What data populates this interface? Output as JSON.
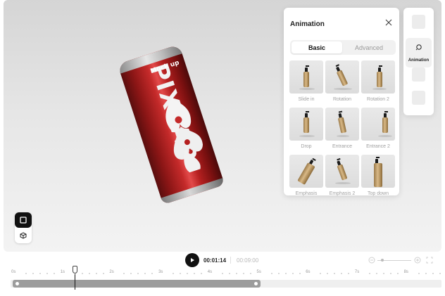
{
  "canvas": {
    "product": {
      "brand_text": "PIXCAP",
      "mock_text": "Mock up"
    }
  },
  "view_toggles": [
    {
      "name": "2d-view",
      "active": true
    },
    {
      "name": "3d-view",
      "active": false
    }
  ],
  "animation_panel": {
    "title": "Animation",
    "tabs": [
      {
        "label": "Basic",
        "active": true
      },
      {
        "label": "Advanced",
        "active": false
      }
    ],
    "presets": [
      {
        "label": "Slide in"
      },
      {
        "label": "Rotation"
      },
      {
        "label": "Rotation 2"
      },
      {
        "label": "Drop"
      },
      {
        "label": "Entrance"
      },
      {
        "label": "Entrance 2"
      },
      {
        "label": "Emphasis"
      },
      {
        "label": "Emphasis 2"
      },
      {
        "label": "Top down"
      }
    ]
  },
  "right_rail": {
    "active_label": "Animation"
  },
  "timeline": {
    "current_time": "00:01:14",
    "total_time": "00:09:00",
    "ruler_labels": [
      "0s",
      "1s",
      "2s",
      "3s",
      "4s",
      "5s",
      "6s",
      "7s",
      "8s"
    ],
    "playhead_seconds": 1.3,
    "clip_end_seconds": 5.0
  },
  "colors": {
    "accent": "#111111",
    "can_red": "#c42a2a",
    "clip": "#9c9c9c"
  }
}
